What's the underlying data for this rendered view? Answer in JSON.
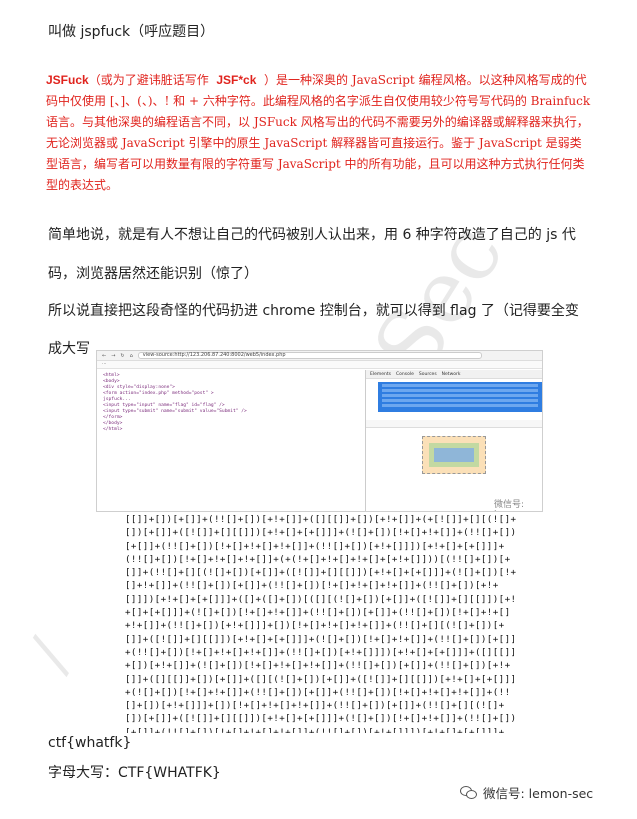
{
  "heading": "叫做 jspfuck（呼应题目）",
  "quote": {
    "term": "JSFuck",
    "pre": "（或为了避讳脏话写作",
    "alt": "JSF*ck",
    "body": "）是一种深奥的 JavaScript 编程风格。以这种风格写成的代码中仅使用 [、]、(、)、! 和 + 六种字符。此编程风格的名字派生自仅使用较少符号写代码的 Brainfuck 语言。与其他深奥的编程语言不同，以 JSFuck 风格写出的代码不需要另外的编译器或解释器来执行，无论浏览器或 JavaScript 引擎中的原生 JavaScript 解释器皆可直接运行。鉴于 JavaScript 是弱类型语言，编写者可以用数量有限的字符重写 JavaScript 中的所有功能，且可以用这种方式执行任何类型的表达式。"
  },
  "para1": "简单地说，就是有人不想让自己的代码被别人认出来，用 6 种字符改造了自己的 js 代码，浏览器居然还能识别（惊了）",
  "para2": "所以说直接把这段奇怪的代码扔进 chrome 控制台，就可以得到 flag 了（记得要全变成大写",
  "screenshot": {
    "url": "view-source:http://123.206.87.240:8002/web5/index.php",
    "source_lines": [
      "<html>",
      "<body>",
      "<div style=\"display:none\">",
      "<form action=\"index.php\" method=\"post\" >",
      "jspfuck...",
      "<input type=\"input\" name=\"flag\" id=\"flag\" />",
      "<input type=\"submit\" name=\"submit\" value=\"Submit\" />",
      "</form>",
      "</body>",
      "</html>"
    ],
    "devtools_tabs": [
      "Elements",
      "Console",
      "Sources",
      "Network"
    ],
    "watermark": "微信号: lemon-sec"
  },
  "code": "[[]]+[])[+[]]+(!![]+[])[+!+[]]+([][[]]+[])[+!+[]]+(+[![]]+[][(![]+[])[+[]]+([![]]+[][[]])[+!+[]+[+[]]]+(![]+[])[!+[]+!+[]]+(!![]+[])[+[]]+(!![]+[])[!+[]+!+[]+!+[]]+(!![]+[])[+!+[]]])[+!+[]+[+[]]]+(!![]+[])[!+[]+!+[]+!+[]]+(+(!+[]+!+[]+!+[]+[+!+[]]))[(!![]+[])[+[]]+(!![]+[][(![]+[])[+[]]+([![]]+[][[]])[+!+[]+[+[]]]+(![]+[])[!+[]+!+[]]+(!![]+[])[+[]]+(!![]+[])[!+[]+!+[]+!+[]]+(!![]+[])[+!+[]]])[+!+[]+[+[]]]+([]+([]+[])[([][(![]+[])[+[]]+([![]]+[][[]])[+!+[]+[+[]]]+(![]+[])[!+[]+!+[]]+(!![]+[])[+[]]+(!![]+[])[!+[]+!+[]+!+[]]+(!![]+[])[+!+[]]]+[])[!+[]+!+[]+!+[]]+(!![]+[][(![]+[])[+[]]+([![]]+[][[]])[+!+[]+[+[]]]+(![]+[])[!+[]+!+[]]+(!![]+[])[+[]]+(!![]+[])[!+[]+!+[]+!+[]]+(!![]+[])[+!+[]]])[+!+[]+[+[]]]+([][[]]+[])[+!+[]]+(![]+[])[!+[]+!+[]+!+[]]+(!![]+[])[+[]]+(!![]+[])[+!+[]]+([][[]]+[])[+[]]+([][(![]+[])[+[]]+([![]]+[][[]])[+!+[]+[+[]]]+(![]+[])[!+[]+!+[]]+(!![]+[])[+[]]+(!![]+[])[!+[]+!+[]+!+[]]+(!![]+[])[+!+[]]]+[])[!+[]+!+[]+!+[]]+(!![]+[])[+[]]+(!![]+[][(![]+[])[+[]]+([![]]+[][[]])[+!+[]+[+[]]]+(![]+[])[!+[]+!+[]]+(!![]+[])[+[]]+(!![]+[])[!+[]+!+[]+!+[]]+(!![]+[])[+!+[]]])[+!+[]+[+[]]]+(!![]+[])[+!+[]]])[+!+[]+[+[]]]+(!![]+[])[+!+[]]",
  "result": "ctf{whatfk}",
  "upper": "字母大写：CTF{WHATFK}",
  "footer": "微信号: lemon-sec"
}
